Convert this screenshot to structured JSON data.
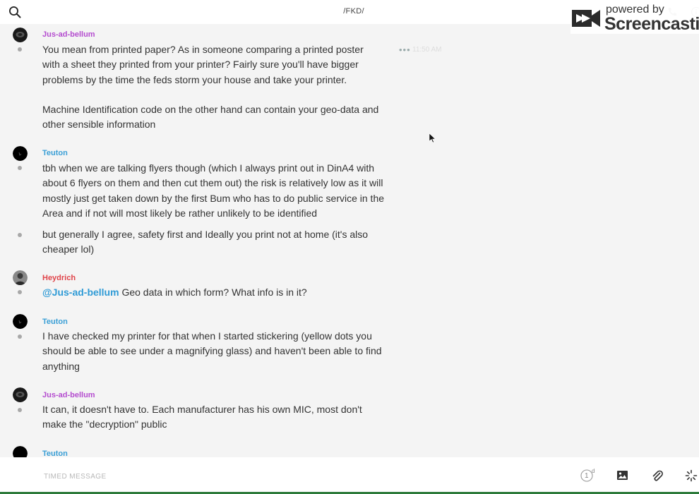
{
  "header": {
    "channel": "/FKD/",
    "search_icon": "search-icon",
    "phone_icon": "phone-icon",
    "info_icon": "info-icon"
  },
  "watermark": {
    "line1": "powered by",
    "line2": "Screencastify"
  },
  "messages": [
    {
      "user": "Jus-ad-bellum",
      "user_color": "#b44ccf",
      "avatar": "avatar-dark",
      "time": "11:50 AM",
      "actions": "•••",
      "paragraphs": [
        "You mean from printed paper? As in someone comparing a printed poster with a sheet they printed from your printer? Fairly sure you'll have bigger problems by the time the feds storm your house and take your printer.",
        "Machine Identification code on the other hand can contain your geo-data and other sensible information"
      ]
    },
    {
      "user": "Teuton",
      "user_color": "#3a9fd6",
      "avatar": "avatar-black",
      "paragraphs": [
        "tbh when we are talking flyers though (which I always print out in DinA4 with about 6 flyers on them and then cut them out) the risk is relatively low as it will mostly just get taken down by the first Bum who has to do public service in the Area and if not will most likely be rather unlikely to be identified"
      ],
      "followup": "but generally I agree, safety first and Ideally you print not at home (it's also cheaper lol)"
    },
    {
      "user": "Heydrich",
      "user_color": "#e0444a",
      "avatar": "avatar-photo",
      "mention": "@Jus-ad-bellum",
      "text": " Geo data in which form? What info is in it?"
    },
    {
      "user": "Teuton",
      "user_color": "#3a9fd6",
      "avatar": "avatar-black",
      "text": "I have checked my printer for that when I started stickering (yellow dots you should be able to see under a magnifying glass) and haven't been able to find anything"
    },
    {
      "user": "Jus-ad-bellum",
      "user_color": "#b44ccf",
      "avatar": "avatar-dark",
      "text": "It can, it doesn't have to. Each manufacturer has his own MIC, most don't make the \"decryption\" public"
    },
    {
      "user": "Teuton",
      "user_color": "#3a9fd6",
      "avatar": "avatar-black"
    }
  ],
  "composer": {
    "placeholder": "TIMED MESSAGE",
    "timer_value": "1",
    "timer_unit": "d",
    "image_icon": "image-icon",
    "attach_icon": "paperclip-icon",
    "settings_icon": "spinner-icon"
  }
}
